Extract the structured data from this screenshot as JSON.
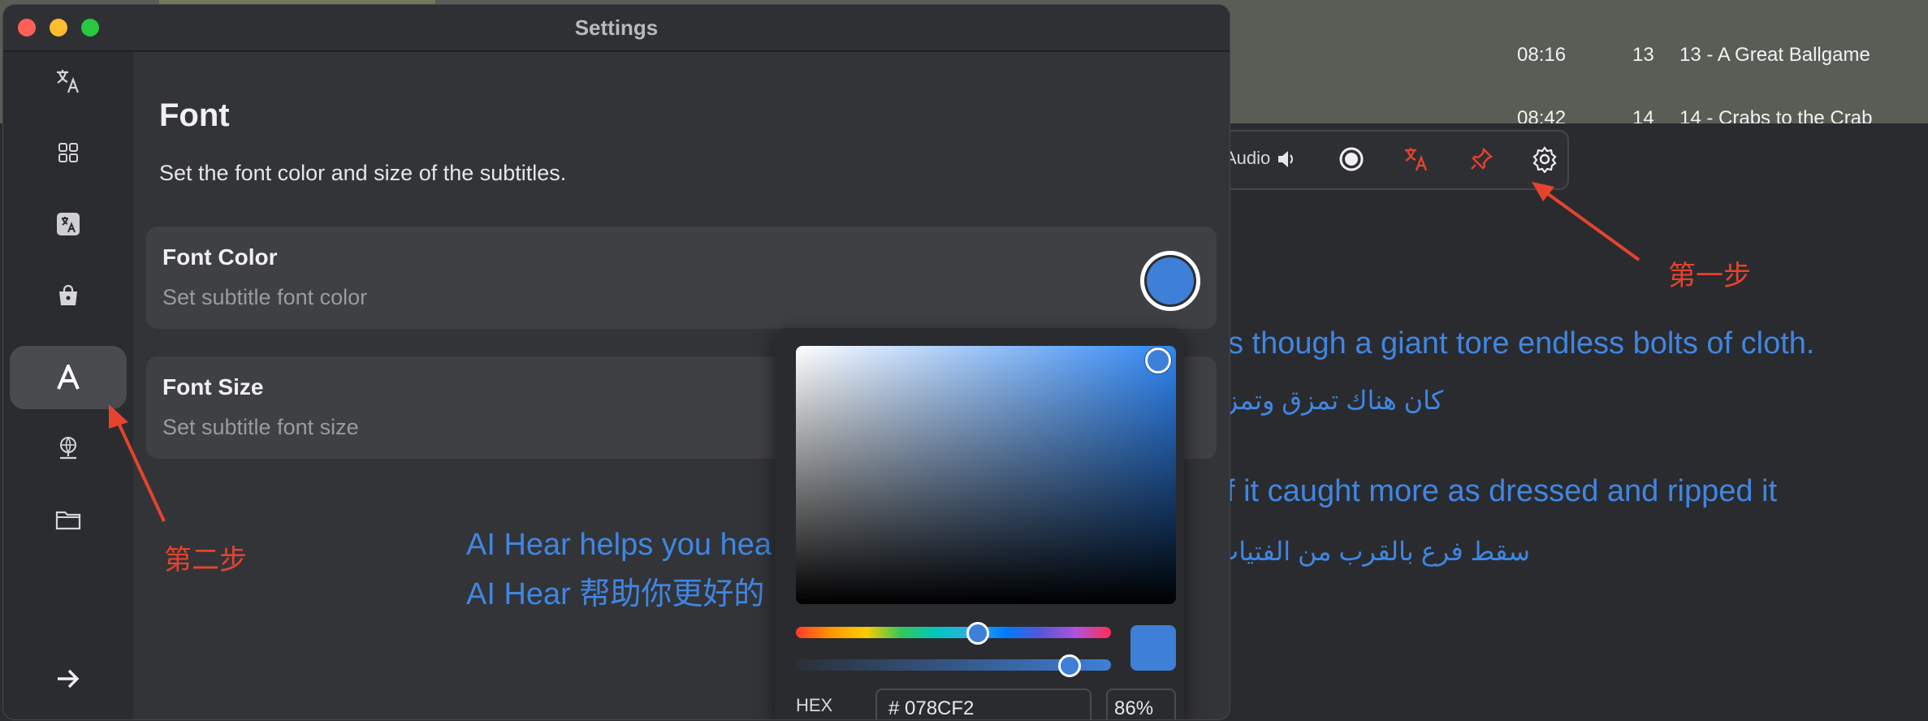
{
  "background_app": {
    "tracks": [
      {
        "time": "08:16",
        "number": "13",
        "title": "13 - A Great Ballgame"
      },
      {
        "time": "08:42",
        "number": "14",
        "title": "14 - Crabs to the Crab"
      }
    ],
    "toolbar": {
      "audio_label": "Audio",
      "icons": [
        "speaker-icon",
        "record-icon",
        "translate-icon",
        "pin-icon",
        "gear-icon"
      ]
    },
    "subtitles": {
      "line1_en": "s though a giant tore endless bolts of cloth.",
      "line1_ar": "كان هناك تمزق وتمز.",
      "line2_en": "f it caught more as dressed and ripped it",
      "line2_ar": "سقط فرع بالقرب من الفتيات"
    },
    "annotations": {
      "step1": "第一步",
      "step2": "第二步"
    },
    "accent_red": "#e5432e",
    "subtitle_color": "#3f86e3"
  },
  "settings_window": {
    "title": "Settings",
    "sidebar": {
      "items": [
        {
          "icon": "translate-icon",
          "active": false
        },
        {
          "icon": "grid-icon",
          "active": false
        },
        {
          "icon": "translate-box-icon",
          "active": false
        },
        {
          "icon": "bag-icon",
          "active": false
        },
        {
          "icon": "font-icon",
          "active": true
        },
        {
          "icon": "globe-icon",
          "active": false
        },
        {
          "icon": "folder-icon",
          "active": false
        }
      ],
      "footer_icon": "arrow-right-icon"
    },
    "page": {
      "heading": "Font",
      "description": "Set the font color and size of the subtitles.",
      "font_color": {
        "title": "Font Color",
        "subtitle": "Set subtitle font color"
      },
      "font_size": {
        "title": "Font Size",
        "subtitle": "Set subtitle font size"
      },
      "preview_line1": "AI Hear helps you hea",
      "preview_line2": "AI Hear 帮助你更好的"
    },
    "color_picker": {
      "selected_color": "#3e7fd8",
      "hue_fraction": 0.57,
      "alpha_fraction": 0.86,
      "format_label": "HEX",
      "hex_value": "# 078CF2",
      "alpha_percent": "86%"
    }
  }
}
